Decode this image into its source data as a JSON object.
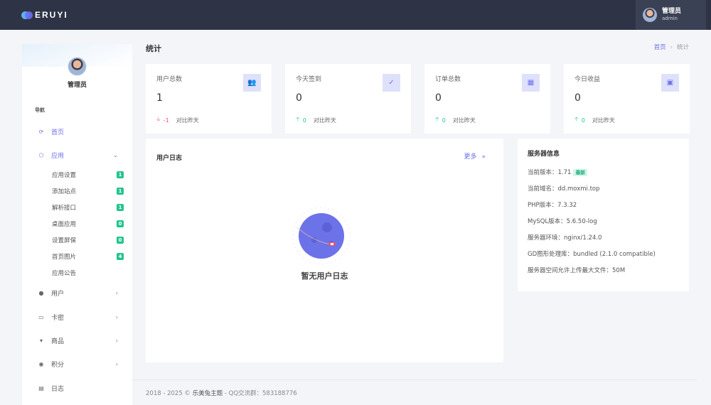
{
  "topbar": {
    "logo_text": "ERUYI",
    "user_name": "管理员",
    "user_role": "admin"
  },
  "sidebar": {
    "user_name": "管理员",
    "nav_heading": "导航",
    "items": [
      {
        "label": "首页",
        "icon": "home-icon"
      },
      {
        "label": "应用",
        "icon": "cube-icon"
      },
      {
        "label": "用户",
        "icon": "user-icon"
      },
      {
        "label": "卡密",
        "icon": "card-icon"
      },
      {
        "label": "商品",
        "icon": "cart-icon"
      },
      {
        "label": "积分",
        "icon": "coin-icon"
      },
      {
        "label": "日志",
        "icon": "clipboard-icon"
      }
    ],
    "sub_items": [
      {
        "label": "应用设置",
        "badge": "1"
      },
      {
        "label": "添加站点",
        "badge": "1"
      },
      {
        "label": "解析接口",
        "badge": "1"
      },
      {
        "label": "桌面应用",
        "badge": "0"
      },
      {
        "label": "设置屏保",
        "badge": "0"
      },
      {
        "label": "首页图片",
        "badge": "4"
      },
      {
        "label": "应用公告",
        "badge": ""
      }
    ]
  },
  "page": {
    "title": "统计",
    "breadcrumb_home": "首页",
    "breadcrumb_current": "统计"
  },
  "stats": [
    {
      "label": "用户总数",
      "value": "1",
      "delta": "-1",
      "direction": "down",
      "compare": "对比昨天",
      "icon": "users-icon"
    },
    {
      "label": "今天签到",
      "value": "0",
      "delta": "0",
      "direction": "up",
      "compare": "对比昨天",
      "icon": "user-check-icon"
    },
    {
      "label": "订单总数",
      "value": "0",
      "delta": "0",
      "direction": "up",
      "compare": "对比昨天",
      "icon": "calendar-icon"
    },
    {
      "label": "今日收益",
      "value": "0",
      "delta": "0",
      "direction": "up",
      "compare": "对比昨天",
      "icon": "money-icon"
    }
  ],
  "log": {
    "title": "用户日志",
    "more_label": "更多",
    "more_arrow": "»",
    "empty_text": "暂无用户日志"
  },
  "server": {
    "title": "服务器信息",
    "rows": [
      "当前版本：1.71",
      "当前域名：dd.moxmi.top",
      "PHP版本：7.3.32",
      "MySQL版本：5.6.50-log",
      "服务器环境：nginx/1.24.0",
      "GD图形处理库：bundled (2.1.0 compatible)",
      "服务器空间允许上传最大文件：50M"
    ],
    "version_tag": "最新"
  },
  "footer": {
    "copyright": "2018 - 2025 ©",
    "brand": "乐美兔主题",
    "qq": "- QQ交流群：583188776"
  },
  "colors": {
    "accent": "#6c72e8",
    "topbar": "#2e3446",
    "success": "#22c58b",
    "danger": "#f0506e"
  }
}
